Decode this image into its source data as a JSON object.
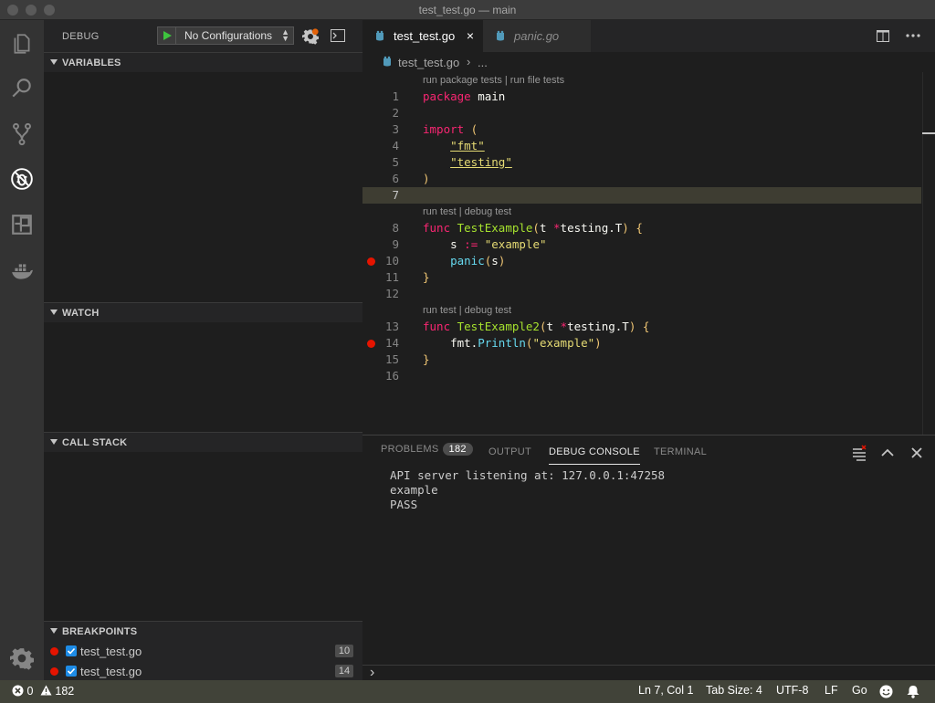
{
  "window": {
    "title": "test_test.go — main"
  },
  "activity_bar": {
    "items": [
      "explorer-icon",
      "search-icon",
      "source-control-icon",
      "debug-icon",
      "extensions-icon",
      "docker-icon"
    ],
    "manage": "gear-icon"
  },
  "debug": {
    "title": "DEBUG",
    "configuration": "No Configurations",
    "sections": {
      "variables": "VARIABLES",
      "watch": "WATCH",
      "call_stack": "CALL STACK",
      "breakpoints": "BREAKPOINTS"
    },
    "breakpoints": [
      {
        "file": "test_test.go",
        "line": "10",
        "enabled": true
      },
      {
        "file": "test_test.go",
        "line": "14",
        "enabled": true
      }
    ]
  },
  "editor": {
    "tabs": [
      {
        "label": "test_test.go",
        "active": true,
        "close": "×"
      },
      {
        "label": "panic.go",
        "active": false
      }
    ],
    "breadcrumb": {
      "file": "test_test.go",
      "sep": "›",
      "rest": "..."
    },
    "codelens": {
      "package": "run package tests | run file tests",
      "test1": "run test | debug test",
      "test2": "run test | debug test"
    },
    "line_numbers": [
      "1",
      "2",
      "3",
      "4",
      "5",
      "6",
      "7",
      "8",
      "9",
      "10",
      "11",
      "12",
      "13",
      "14",
      "15",
      "16"
    ],
    "current_line": "7",
    "code": {
      "l1_kw": "package",
      "l1_rest": " main",
      "l3_kw": "import",
      "l3_paren": " (",
      "l4_str": "\"fmt\"",
      "l5_str": "\"testing\"",
      "l6_paren": ")",
      "l8_kw": "func",
      "l8_fn": " TestExample",
      "l8_p1": "(",
      "l8_a": "t ",
      "l8_star": "*",
      "l8_t": "testing.T",
      "l8_p2": ")",
      "l8_b": " {",
      "l9_a": "s ",
      "l9_op": ":=",
      "l9_str": " \"example\"",
      "l10_fn": "panic",
      "l10_p1": "(",
      "l10_a": "s",
      "l10_p2": ")",
      "l11": "}",
      "l13_kw": "func",
      "l13_fn": " TestExample2",
      "l13_p1": "(",
      "l13_a": "t ",
      "l13_star": "*",
      "l13_t": "testing.T",
      "l13_p2": ")",
      "l13_b": " {",
      "l14_a": "fmt.",
      "l14_fn": "Println",
      "l14_p1": "(",
      "l14_str": "\"example\"",
      "l14_p2": ")",
      "l15": "}"
    }
  },
  "panel": {
    "tabs": {
      "problems": "PROBLEMS",
      "problems_count": "182",
      "output": "OUTPUT",
      "debug_console": "DEBUG CONSOLE",
      "terminal": "TERMINAL"
    },
    "console_lines": [
      "API server listening at: 127.0.0.1:47258",
      "example",
      "PASS"
    ],
    "prompt": "›"
  },
  "status": {
    "errors": "0",
    "warnings": "182",
    "position": "Ln 7, Col 1",
    "tab_size": "Tab Size: 4",
    "encoding": "UTF-8",
    "eol": "LF",
    "language": "Go"
  },
  "colors": {
    "accent": "#1e8ce6",
    "breakpoint": "#e51400",
    "statusbar": "#414339",
    "keyword": "#f92672",
    "function": "#a6e22e",
    "string": "#e6db74"
  }
}
